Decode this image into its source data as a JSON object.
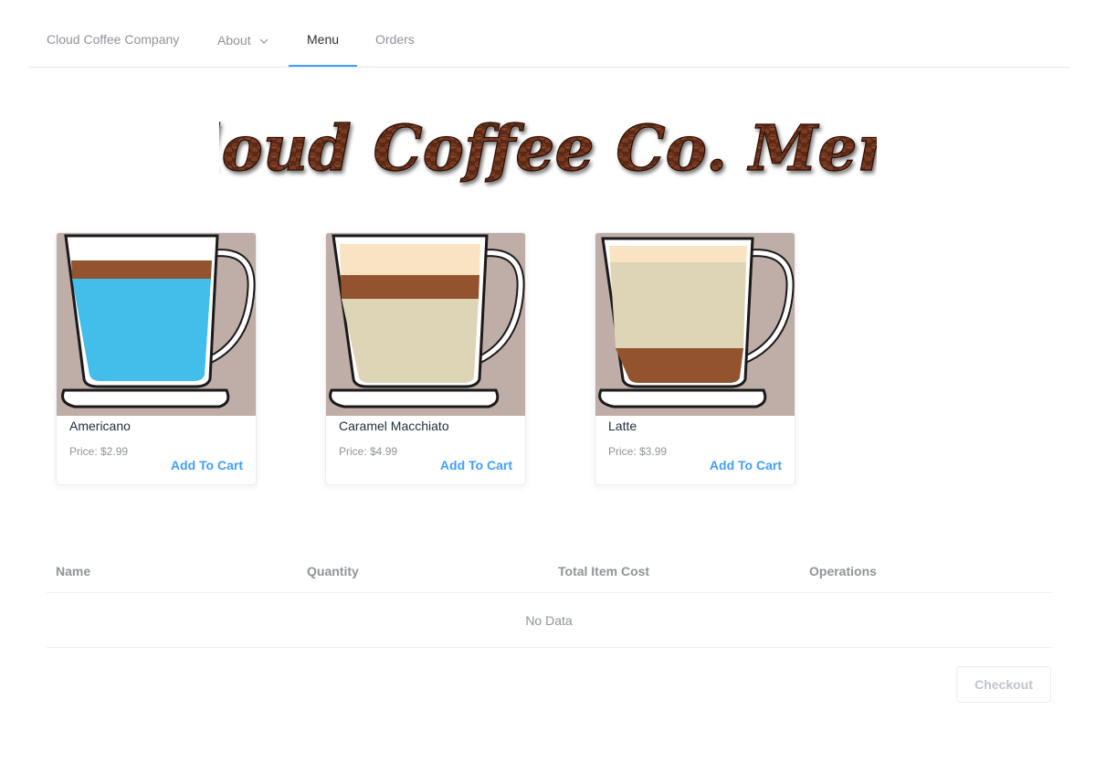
{
  "nav": {
    "brand": "Cloud Coffee Company",
    "about": "About",
    "menu": "Menu",
    "orders": "Orders",
    "active": "Menu"
  },
  "banner": {
    "text": "Cloud Coffee Co. Menu"
  },
  "products": [
    {
      "name": "Americano",
      "price": "Price: $2.99",
      "add_label": "Add To Cart"
    },
    {
      "name": "Caramel Macchiato",
      "price": "Price: $4.99",
      "add_label": "Add To Cart"
    },
    {
      "name": "Latte",
      "price": "Price: $3.99",
      "add_label": "Add To Cart"
    }
  ],
  "cart": {
    "columns": [
      "Name",
      "Quantity",
      "Total Item Cost",
      "Operations"
    ],
    "empty_text": "No Data",
    "checkout_label": "Checkout"
  },
  "colors": {
    "accent": "#409eff",
    "card_bg": "#bfada7",
    "espresso": "#93532f",
    "water": "#43bde9",
    "milk": "#ded4b6",
    "foam": "#f9e3c3"
  },
  "icons": {
    "about_dropdown": "chevron-down-icon"
  }
}
